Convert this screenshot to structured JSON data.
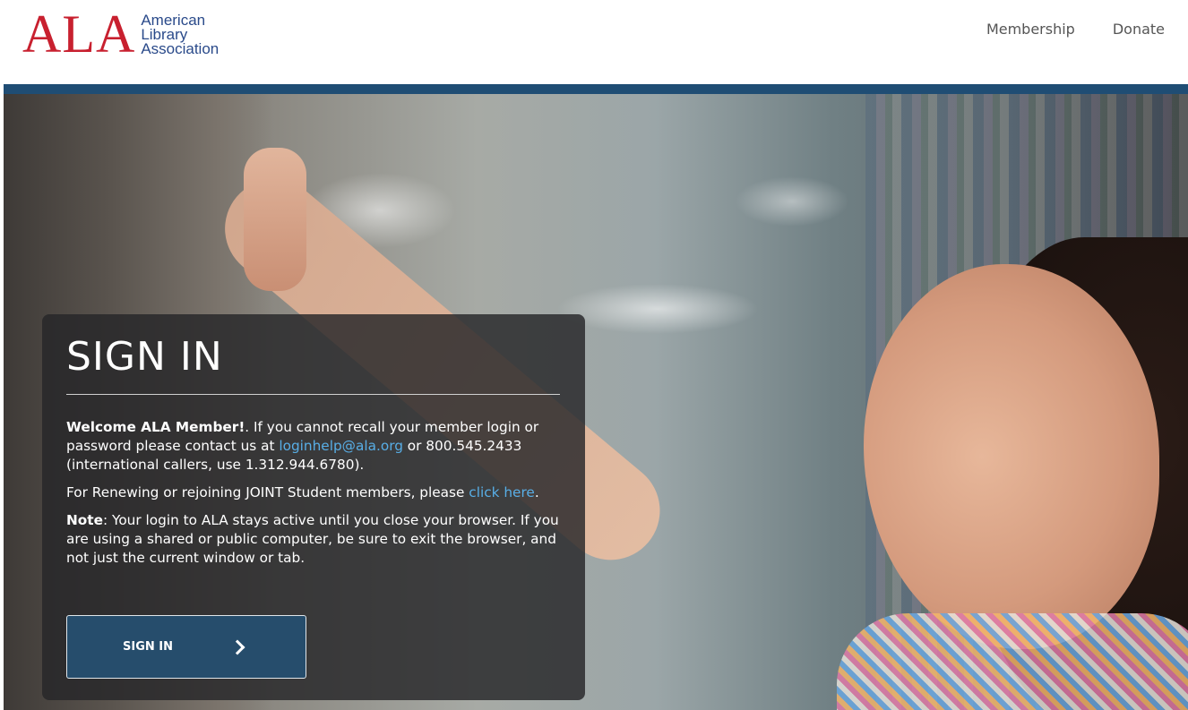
{
  "header": {
    "logo_mark": "ALA",
    "logo_line1": "American",
    "logo_line2": "Library",
    "logo_line3": "Association",
    "nav": [
      {
        "label": "Membership"
      },
      {
        "label": "Donate"
      }
    ]
  },
  "signin": {
    "title": "SIGN IN",
    "welcome_bold": "Welcome ALA Member!",
    "welcome_text": ". If you cannot recall your member login or password please contact us at ",
    "email_link": "loginhelp@ala.org",
    "phone_text": " or 800.545.2433 (international callers, use 1.312.944.6780).",
    "renew_text": "For Renewing or rejoining JOINT Student members, please ",
    "renew_link": "click here",
    "renew_end": ".",
    "note_bold": "Note",
    "note_text": ": Your login to ALA stays active until you close your browser. If you are using a shared or public computer, be sure to exit the browser, and not just the current window or tab.",
    "button_label": "SIGN IN"
  },
  "colors": {
    "brand_red": "#c8202f",
    "brand_blue": "#2a4a8a",
    "top_bar": "#1f4d74",
    "button_bg": "#264d6c",
    "link": "#58aee6"
  },
  "icons": {
    "button_icon": "chevron-right-icon"
  }
}
